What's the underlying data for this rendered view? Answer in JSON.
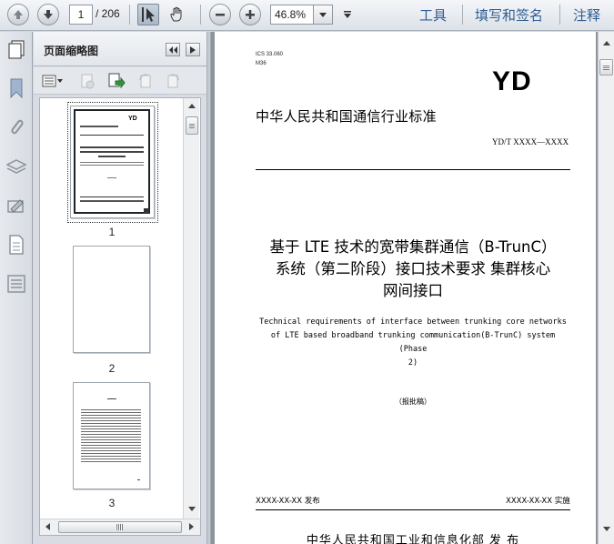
{
  "toolbar": {
    "current_page": "1",
    "total_pages": "/ 206",
    "zoom": "46.8%",
    "links": {
      "tools": "工具",
      "fill_sign": "填写和签名",
      "comment": "注释"
    }
  },
  "side_icons": [
    "pages-icon",
    "bookmark-icon",
    "attachment-icon",
    "layers-icon",
    "signature-icon",
    "document-icon",
    "compare-icon"
  ],
  "panel": {
    "title": "页面缩略图",
    "thumbnails": [
      {
        "label": "1"
      },
      {
        "label": "2"
      },
      {
        "label": "3"
      }
    ]
  },
  "document": {
    "ics": "ICS  33.060",
    "class_code": "M36",
    "logo": "YD",
    "standard_name": "中华人民共和国通信行业标准",
    "standard_no": "YD/T XXXX—XXXX",
    "title_zh_line1": "基于 LTE 技术的宽带集群通信（B-TrunC）",
    "title_zh_line2": "系统（第二阶段）接口技术要求  集群核心",
    "title_zh_line3": "网间接口",
    "title_en_line1": "Technical requirements of interface between trunking core networks",
    "title_en_line2": "of LTE based broadband trunking communication(B-TrunC) system (Phase",
    "title_en_line3": "2)",
    "draft": "（报批稿）",
    "pub_date": "XXXX-XX-XX 发布",
    "eff_date": "XXXX-XX-XX 实施",
    "issuer": "中华人民共和国工业和信息化部    发 布"
  }
}
